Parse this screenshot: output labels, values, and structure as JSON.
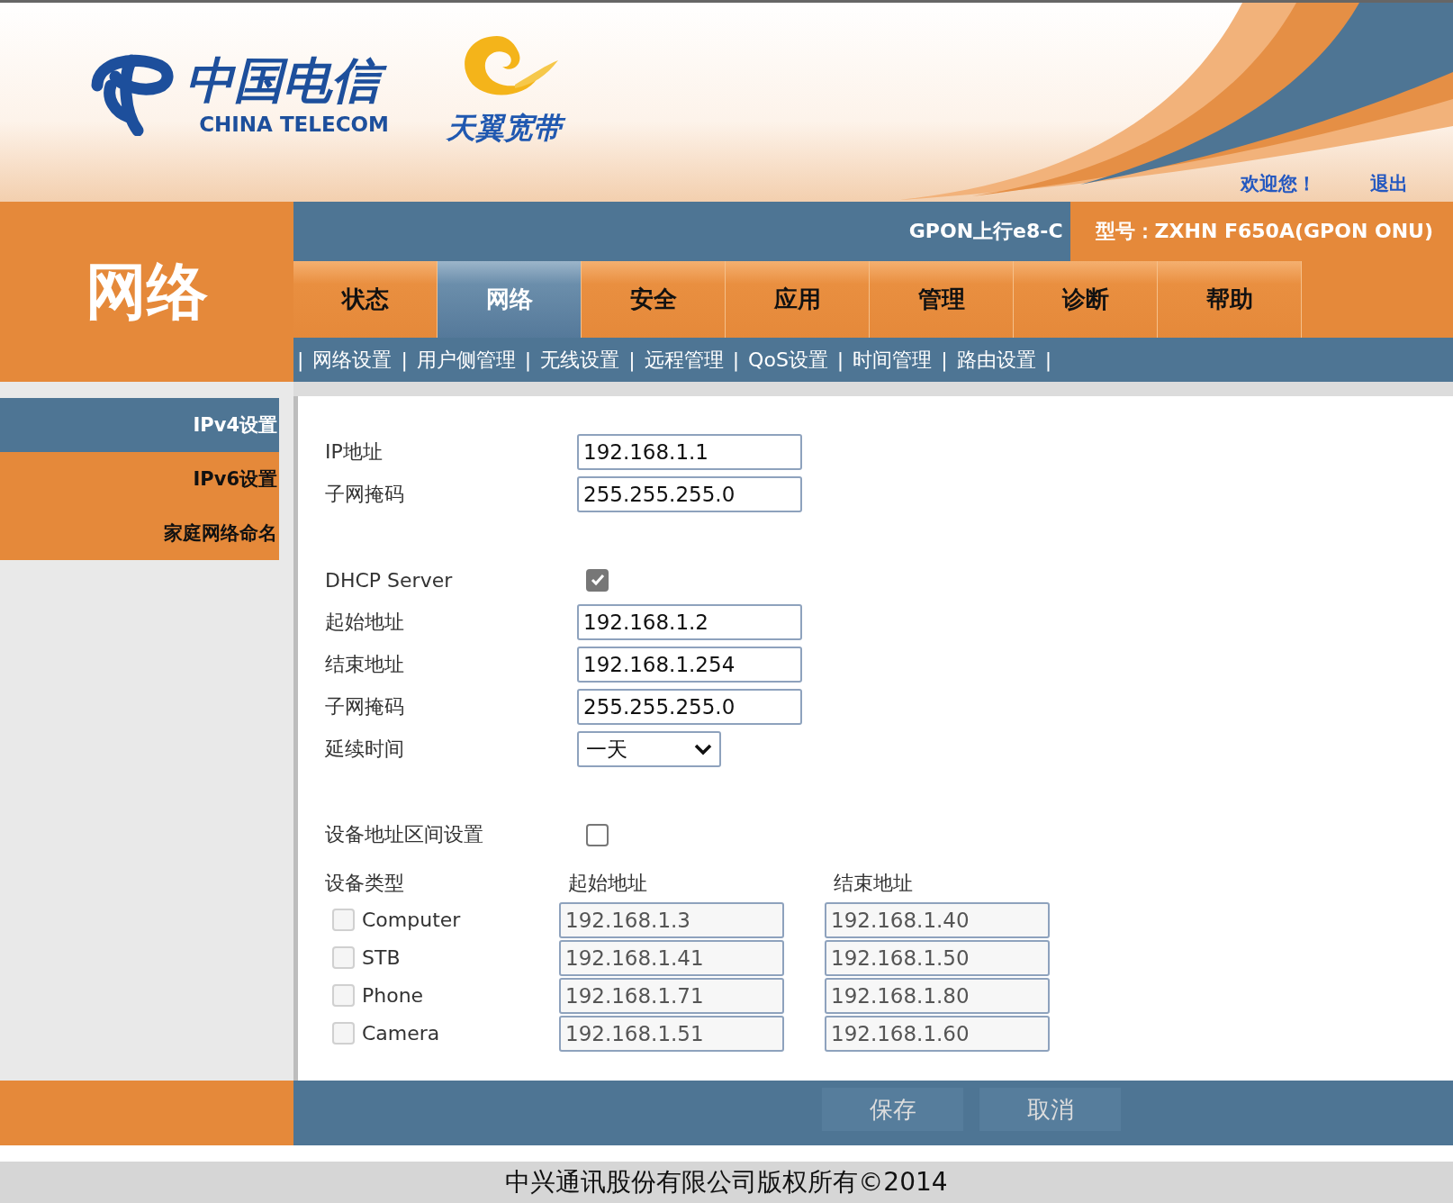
{
  "header": {
    "logo_name": "中国电信",
    "logo_subtitle": "CHINA TELECOM",
    "brand": "天翼宽带",
    "welcome": "欢迎您！",
    "logout": "退出"
  },
  "section_title": "网络",
  "info_bar": {
    "version": "GPON上行e8-C",
    "model": "型号：ZXHN F650A(GPON ONU)"
  },
  "tabs": [
    {
      "label": "状态",
      "selected": false
    },
    {
      "label": "网络",
      "selected": true
    },
    {
      "label": "安全",
      "selected": false
    },
    {
      "label": "应用",
      "selected": false
    },
    {
      "label": "管理",
      "selected": false
    },
    {
      "label": "诊断",
      "selected": false
    },
    {
      "label": "帮助",
      "selected": false
    }
  ],
  "submenu": {
    "separator": "|",
    "items": [
      "网络设置",
      "用户侧管理",
      "无线设置",
      "远程管理",
      "QoS设置",
      "时间管理",
      "路由设置"
    ]
  },
  "sidebar": {
    "items": [
      {
        "label": "IPv4设置",
        "selected": true
      },
      {
        "label": "IPv6设置",
        "selected": false
      },
      {
        "label": "家庭网络命名",
        "selected": false
      }
    ]
  },
  "form": {
    "groups": [
      [
        {
          "kind": "text",
          "label": "IP地址",
          "value": "192.168.1.1"
        },
        {
          "kind": "text",
          "label": "子网掩码",
          "value": "255.255.255.0"
        }
      ],
      [
        {
          "kind": "checkbox",
          "label": "DHCP Server",
          "checked": true
        },
        {
          "kind": "text",
          "label": "起始地址",
          "value": "192.168.1.2"
        },
        {
          "kind": "text",
          "label": "结束地址",
          "value": "192.168.1.254"
        },
        {
          "kind": "text",
          "label": "子网掩码",
          "value": "255.255.255.0"
        },
        {
          "kind": "select",
          "label": "延续时间",
          "value": "一天"
        }
      ],
      [
        {
          "kind": "checkbox",
          "label": "设备地址区间设置",
          "checked": false
        }
      ]
    ]
  },
  "device_table": {
    "columns": [
      "设备类型",
      "起始地址",
      "结束地址"
    ],
    "rows": [
      {
        "name": "Computer",
        "checked": false,
        "disabled": true,
        "start": "192.168.1.3",
        "end": "192.168.1.40"
      },
      {
        "name": "STB",
        "checked": false,
        "disabled": true,
        "start": "192.168.1.41",
        "end": "192.168.1.50"
      },
      {
        "name": "Phone",
        "checked": false,
        "disabled": true,
        "start": "192.168.1.71",
        "end": "192.168.1.80"
      },
      {
        "name": "Camera",
        "checked": false,
        "disabled": true,
        "start": "192.168.1.51",
        "end": "192.168.1.60"
      }
    ]
  },
  "buttons": [
    "保存",
    "取消"
  ],
  "footer": "中兴通讯股份有限公司版权所有©2014"
}
